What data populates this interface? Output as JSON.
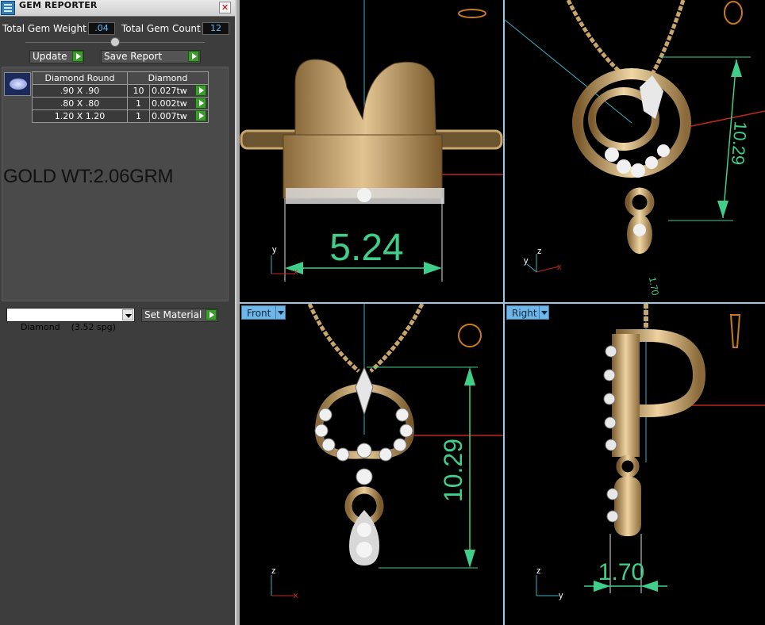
{
  "window": {
    "title": "GEM REPORTER",
    "close_glyph": "✕"
  },
  "totals": {
    "weight_label": "Total Gem Weight",
    "weight_value": ".04",
    "count_label": "Total Gem Count",
    "count_value": "12"
  },
  "actions": {
    "update_label": "Update",
    "save_report_label": "Save Report"
  },
  "gem_table": {
    "headers": [
      "Diamond Round",
      "Diamond"
    ],
    "rows": [
      {
        "size": ".90 X .90",
        "count": "10",
        "weight": "0.027tw"
      },
      {
        "size": ".80 X .80",
        "count": "1",
        "weight": "0.002tw"
      },
      {
        "size": "1.20 X 1.20",
        "count": "1",
        "weight": "0.007tw"
      }
    ]
  },
  "gold_weight_note": "GOLD WT:2.06GRM",
  "material": {
    "selected": "Diamond    (3.52 spg)",
    "set_label": "Set Material"
  },
  "viewports": {
    "top_left": {
      "dimension": "5.24"
    },
    "top_right": {
      "dimension_main": "10.29",
      "dimension_small": "1.70"
    },
    "bottom_left": {
      "label": "Front",
      "dimension": "10.29"
    },
    "bottom_right": {
      "label": "Right",
      "dimension": "1.70"
    },
    "axes": {
      "x": "x",
      "y": "y",
      "z": "z"
    }
  },
  "colors": {
    "viewport_label_bg": "#6fb6e6",
    "dimension_green": "#3fcf8a",
    "gold_metal": "#c9a56a",
    "value_text_blue": "#5fb8ff"
  }
}
